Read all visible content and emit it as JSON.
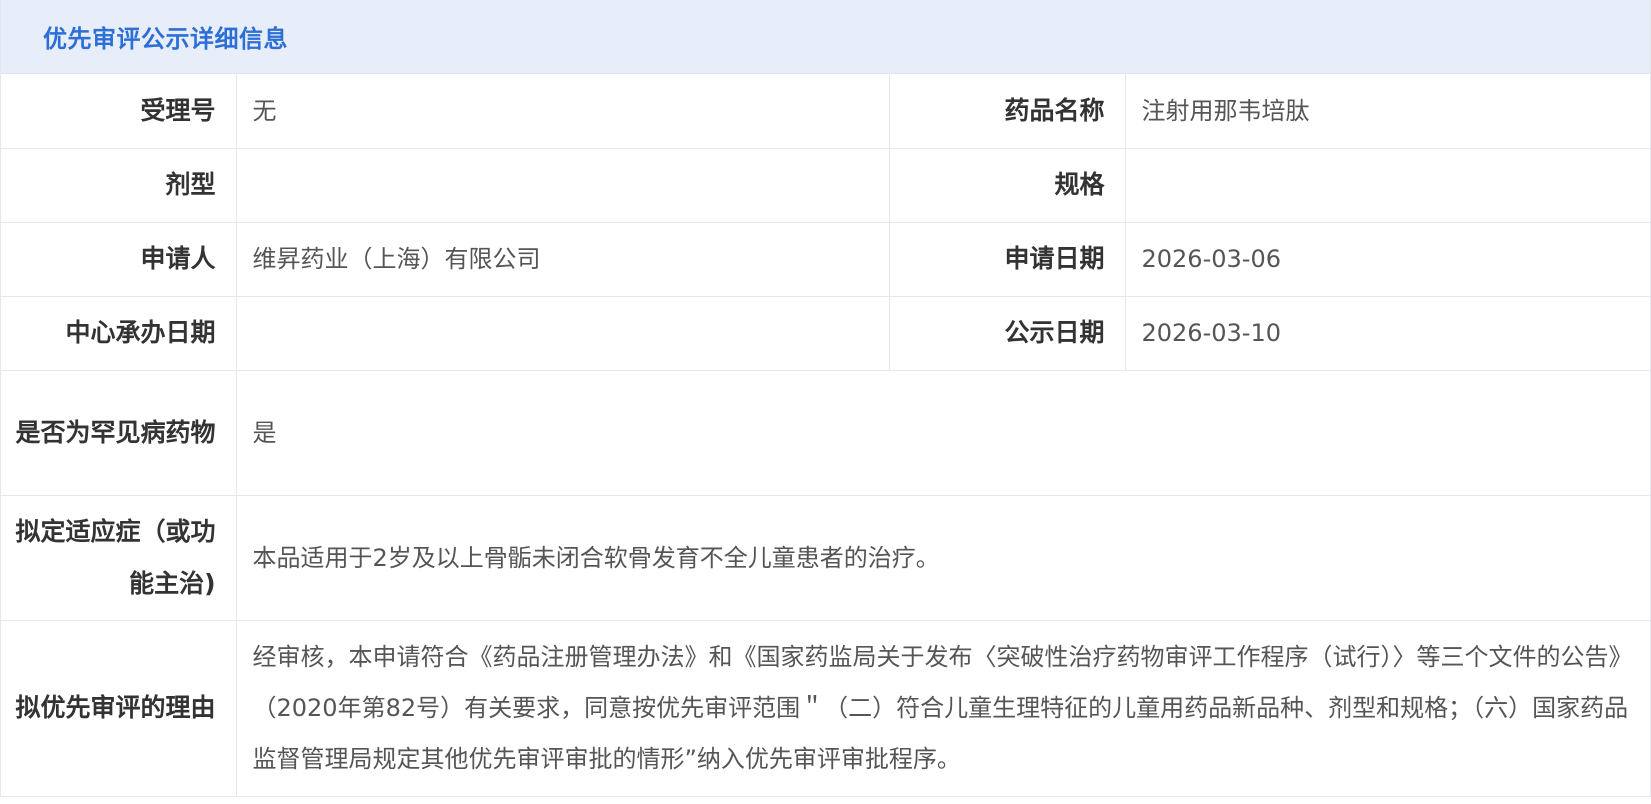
{
  "panel": {
    "title": "优先审评公示详细信息"
  },
  "fields": {
    "acceptance_no": {
      "label": "受理号",
      "value": "无"
    },
    "drug_name": {
      "label": "药品名称",
      "value": "注射用那韦培肽"
    },
    "dosage_form": {
      "label": "剂型",
      "value": ""
    },
    "specification": {
      "label": "规格",
      "value": ""
    },
    "applicant": {
      "label": "申请人",
      "value": "维昇药业（上海）有限公司"
    },
    "application_date": {
      "label": "申请日期",
      "value": "2026-03-06"
    },
    "center_date": {
      "label": "中心承办日期",
      "value": ""
    },
    "publicity_date": {
      "label": "公示日期",
      "value": "2026-03-10"
    },
    "rare_disease": {
      "label": "是否为罕见病药物",
      "value": "是"
    },
    "indication": {
      "label": "拟定适应症（或功能主治)",
      "value": "本品适用于2岁及以上骨骺未闭合软骨发育不全儿童患者的治疗。"
    },
    "reason": {
      "label": "拟优先审评的理由",
      "value": "经审核，本申请符合《药品注册管理办法》和《国家药监局关于发布〈突破性治疗药物审评工作程序（试行）〉等三个文件的公告》（2020年第82号）有关要求，同意按优先审评范围＂（二）符合儿童生理特征的儿童用药品新品种、剂型和规格；（六）国家药品监督管理局规定其他优先审评审批的情形”纳入优先审评审批程序。"
    }
  }
}
